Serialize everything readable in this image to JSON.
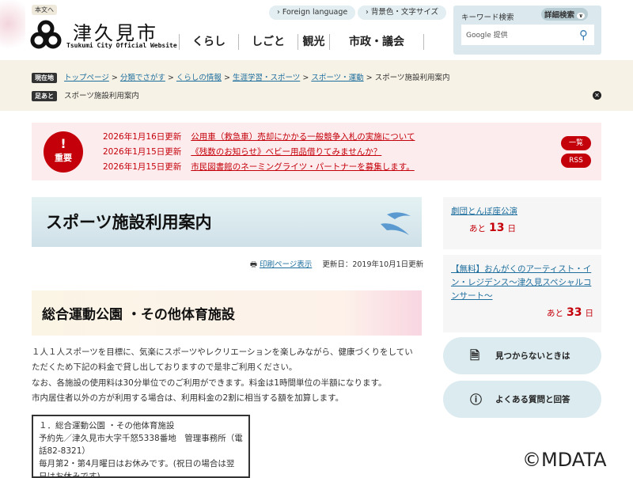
{
  "header": {
    "skip_link": "本文へ",
    "site_name": "津久見市",
    "site_sub": "Tsukumi City Official Website",
    "foreign_language": "Foreign language",
    "bg_font": "背景色・文字サイズ",
    "nav": [
      "くらし",
      "しごと",
      "観光",
      "市政・議会"
    ]
  },
  "search": {
    "label": "キーワード検索",
    "advanced": "詳細検索",
    "placeholder": "Google 提供"
  },
  "breadcrumb": {
    "tag": "現在地",
    "items": [
      "トップページ",
      "分類でさがす",
      "くらしの情報",
      "生涯学習・スポーツ",
      "スポーツ・運動"
    ],
    "current": "スポーツ施設利用案内",
    "sep": ">"
  },
  "footprint": {
    "tag": "足あと",
    "item": "スポーツ施設利用案内"
  },
  "alert": {
    "badge": "重要",
    "mark": "!",
    "items": [
      {
        "date": "2026年1月16日更新",
        "title": "公用車（救急車）売却にかかる一般競争入札の実施について"
      },
      {
        "date": "2026年1月15日更新",
        "title": "《残数のお知らせ》ベビー用品借りてみませんか？"
      },
      {
        "date": "2026年1月15日更新",
        "title": "市民図書館のネーミングライツ・パートナーを募集します。"
      }
    ],
    "list_button": "一覧",
    "rss_button": "RSS"
  },
  "page": {
    "title": "スポーツ施設利用案内",
    "print": "印刷ページ表示",
    "updated": "更新日：2019年10月1日更新",
    "section": "総合運動公園 ・その他体育施設",
    "paragraphs": [
      "１人１人スポーツを目標に、気楽にスポーツやレクリエーションを楽しみながら、健康づくりをしてい",
      "ただくため下記の料金で貸し出しておりますので是非ご利用ください。",
      "なお、各施設の使用料は30分単位でのご利用ができます。料金は1時間単位の半額になります。",
      "市内居住者以外の方が利用する場合は、利用料金の2割に相当する額を加算します。"
    ],
    "box": [
      "１．総合運動公園 ・その他体育施設",
      "予約先／津久見市大字千怒5338番地　管理事務所（電",
      "話82-8321）",
      "毎月第2・第4月曜日はお休みです。(祝日の場合は翌",
      "日はお休みです)"
    ]
  },
  "sidebar": {
    "events": [
      {
        "title": "劇団とんぼ座公演",
        "prefix": "あと",
        "days": "13",
        "suffix": "日"
      },
      {
        "title": "【無料】おんがくのアーティスト・イン・レジデンス～津久見スペシャルコンサート～",
        "prefix": "あと",
        "days": "33",
        "suffix": "日"
      }
    ],
    "not_found": "見つからないときは",
    "faq": "よくある質問と回答"
  },
  "watermark": "©MDATA"
}
